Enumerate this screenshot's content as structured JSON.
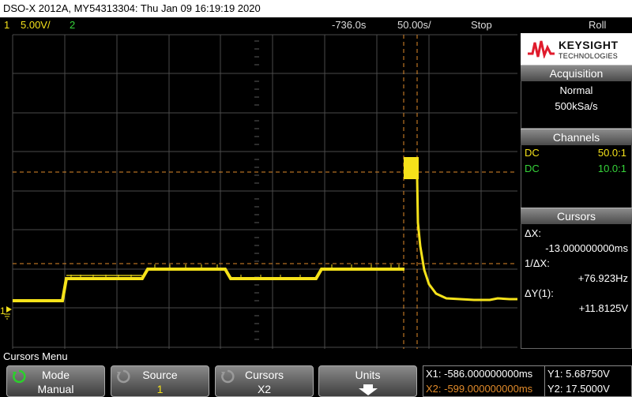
{
  "title": "DSO-X 2012A, MY54313304: Thu Jan 09 16:19:19 2020",
  "status": {
    "ch1_num": "1",
    "ch1_scale": "5.00V/",
    "ch2_num": "2",
    "delay": "-736.0s",
    "timebase": "50.00s/",
    "run_state": "Stop",
    "mode": "Roll"
  },
  "logo": {
    "brand": "KEYSIGHT",
    "sub": "TECHNOLOGIES"
  },
  "acquisition": {
    "header": "Acquisition",
    "mode": "Normal",
    "rate": "500kSa/s"
  },
  "channels": {
    "header": "Channels",
    "rows": [
      {
        "coupling": "DC",
        "probe": "50.0:1",
        "color": "#f5e21a"
      },
      {
        "coupling": "DC",
        "probe": "10.0:1",
        "color": "#36d43a"
      }
    ]
  },
  "cursors": {
    "header": "Cursors",
    "dx_label": "ΔX:",
    "dx_value": "-13.000000000ms",
    "inv_dx_label": "1/ΔX:",
    "inv_dx_value": "+76.923Hz",
    "dy_label": "ΔY(1):",
    "dy_value": "+11.8125V"
  },
  "menu_title": "Cursors Menu",
  "softkeys": [
    {
      "label": "Mode",
      "value": "Manual",
      "spin": true
    },
    {
      "label": "Source",
      "value": "1",
      "spin": true
    },
    {
      "label": "Cursors",
      "value": "X2",
      "spin": true
    },
    {
      "label": "Units",
      "value": "",
      "spin": false
    }
  ],
  "readouts": {
    "x1": "X1: -586.000000000ms",
    "x2": "X2: -599.000000000ms",
    "y1": "Y1: 5.68750V",
    "y2": "Y2: 17.5000V"
  },
  "colors": {
    "ch1": "#f5e21a",
    "ch2": "#36d43a",
    "cursor": "#e08a2a",
    "grid": "#4a4a4a"
  }
}
